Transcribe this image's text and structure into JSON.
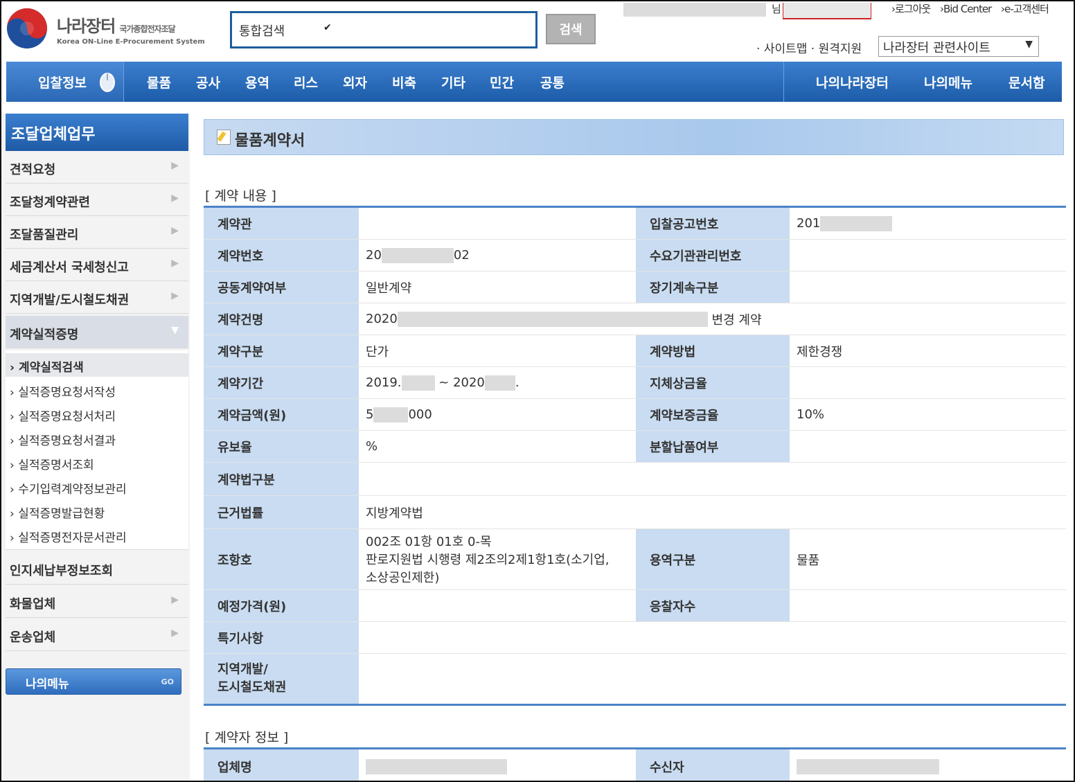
{
  "header": {
    "logo_title": "나라장터",
    "logo_title_small": "국가종합전자조달",
    "logo_subtitle": "Korea ON-Line E-Procurement System",
    "search_select": "통합검색",
    "search_button": "검색",
    "user_suffix": "님",
    "top_links": [
      "›로그아웃",
      "›Bid Center",
      "›e-고객센터"
    ],
    "util_links": "· 사이트맵 · 원격지원",
    "related_sites": "나라장터 관련사이트"
  },
  "nav": {
    "first": "입찰정보",
    "items": [
      "물품",
      "공사",
      "용역",
      "리스",
      "외자",
      "비축",
      "기타",
      "민간",
      "공통"
    ],
    "right": [
      "나의나라장터",
      "나의메뉴",
      "문서함"
    ]
  },
  "sidebar": {
    "title": "조달업체업무",
    "items": [
      "견적요청",
      "조달청계약관련",
      "조달품질관리",
      "세금계산서 국세청신고",
      "지역개발/도시철도채권",
      "계약실적증명"
    ],
    "sub_items": [
      "계약실적검색",
      "실적증명요청서작성",
      "실적증명요청서처리",
      "실적증명요청서결과",
      "실적증명서조회",
      "수기입력계약정보관리",
      "실적증명발급현황",
      "실적증명전자문서관리"
    ],
    "items_after": [
      "인지세납부정보조회",
      "화물업체",
      "운송업체"
    ],
    "my_menu": "나의메뉴",
    "my_menu_go": "GO"
  },
  "page": {
    "title": "물품계약서",
    "section1": "[ 계약 내용 ]",
    "section2": "[ 계약자 정보 ]"
  },
  "contract": {
    "r1": {
      "l1": "계약관",
      "v1": "",
      "l2": "입찰공고번호",
      "v2": "201"
    },
    "r2": {
      "l1": "계약번호",
      "v1a": "20",
      "v1b": "02",
      "l2": "수요기관관리번호",
      "v2": ""
    },
    "r3": {
      "l1": "공동계약여부",
      "v1": "일반계약",
      "l2": "장기계속구분",
      "v2": ""
    },
    "r4": {
      "l1": "계약건명",
      "v1a": "2020",
      "v1b": "변경 계약"
    },
    "r5": {
      "l1": "계약구분",
      "v1": "단가",
      "l2": "계약방법",
      "v2": "제한경쟁"
    },
    "r6": {
      "l1": "계약기간",
      "v1a": "2019.",
      "v1b": "~ 2020",
      "v1c": ".",
      "l2": "지체상금율",
      "v2": ""
    },
    "r7": {
      "l1": "계약금액(원)",
      "v1a": "5",
      "v1b": "000",
      "l2": "계약보증금율",
      "v2": "10%"
    },
    "r8": {
      "l1": "유보율",
      "v1": "%",
      "l2": "분할납품여부",
      "v2": ""
    },
    "r9": {
      "l1": "계약법구분",
      "v1": ""
    },
    "r10": {
      "l1": "근거법률",
      "v1": "지방계약법"
    },
    "r11": {
      "l1": "조항호",
      "v1_line1": "002조 01항 01호 0-목",
      "v1_line2": "판로지원법 시행령 제2조의2제1항1호(소기업,",
      "v1_line3": "소상공인제한)",
      "l2": "용역구분",
      "v2": "물품"
    },
    "r12": {
      "l1": "예정가격(원)",
      "v1": "",
      "l2": "응찰자수",
      "v2": ""
    },
    "r13": {
      "l1": "특기사항",
      "v1": ""
    },
    "r14": {
      "l1a": "지역개발/",
      "l1b": "도시철도채권",
      "v1": ""
    }
  },
  "contractor": {
    "l1": "업체명",
    "l2": "수신자"
  },
  "colors": {
    "accent": "#1c5ca8",
    "header_cell": "#c9dcf1",
    "rule": "#4a83c8"
  }
}
